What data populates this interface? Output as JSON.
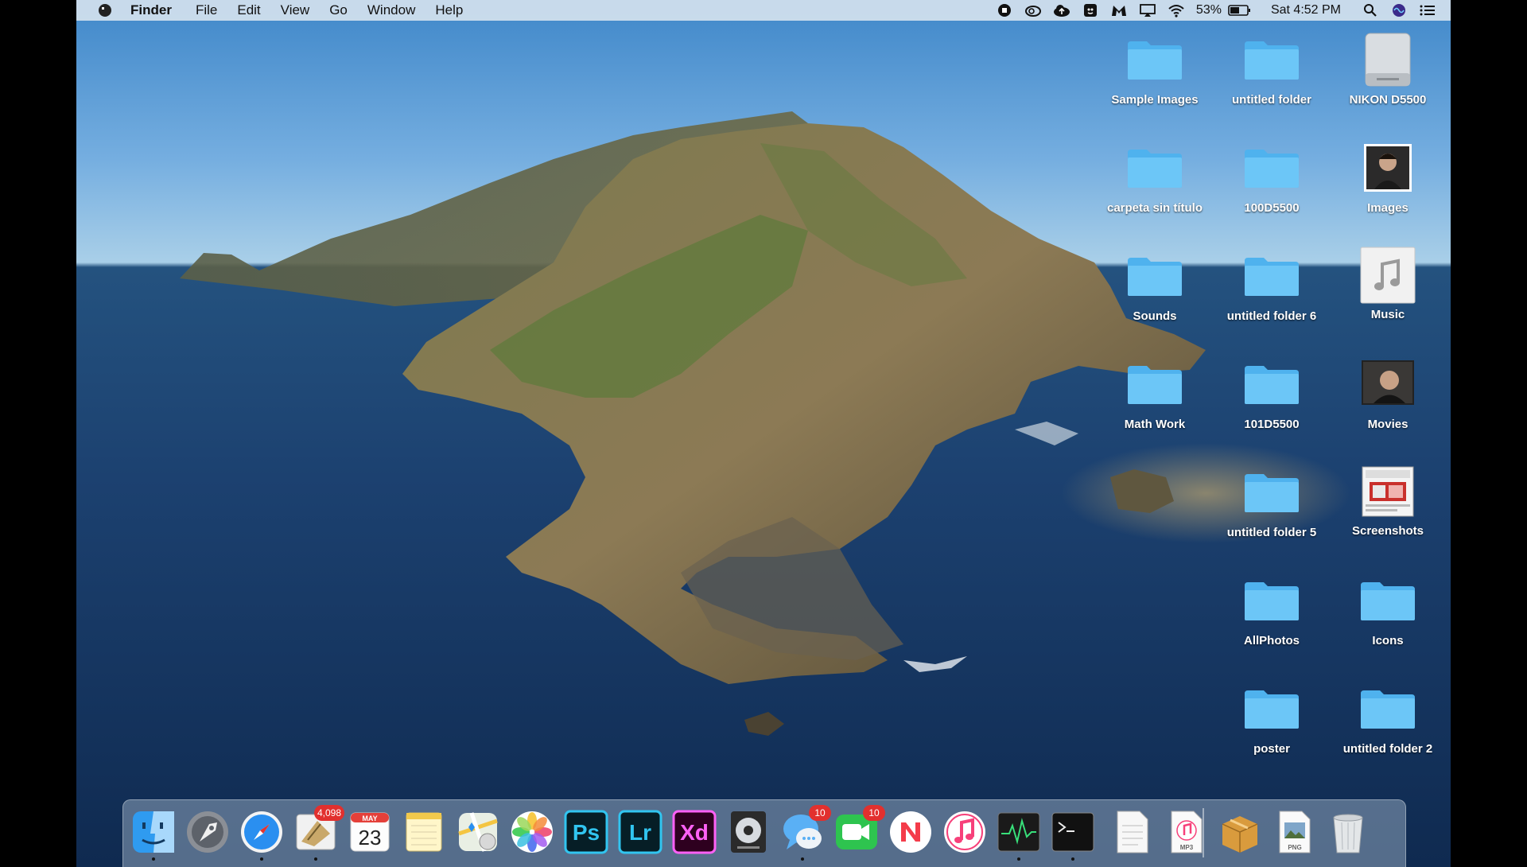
{
  "menubar": {
    "app_name": "Finder",
    "menus": [
      "File",
      "Edit",
      "View",
      "Go",
      "Window",
      "Help"
    ],
    "battery": "53%",
    "clock": "Sat 4:52 PM",
    "status_icons": [
      "record-icon",
      "creative-cloud-icon",
      "cloud-upload-icon",
      "ghostery-icon",
      "malwarebytes-icon",
      "airplay-icon",
      "wifi-icon",
      "battery-icon",
      "spotlight-icon",
      "siri-icon",
      "notification-center-icon"
    ]
  },
  "desktop": {
    "items": [
      {
        "label": "Sample Images",
        "icon": "folder-icon"
      },
      {
        "label": "untitled folder",
        "icon": "folder-icon"
      },
      {
        "label": "NIKON D5500",
        "icon": "drive-icon"
      },
      {
        "label": "carpeta sin título",
        "icon": "folder-icon"
      },
      {
        "label": "100D5500",
        "icon": "folder-icon"
      },
      {
        "label": "Images",
        "icon": "portrait-thumbnail-icon"
      },
      {
        "label": "Sounds",
        "icon": "folder-icon"
      },
      {
        "label": "untitled folder 6",
        "icon": "folder-icon"
      },
      {
        "label": "Music",
        "icon": "music-file-icon"
      },
      {
        "label": "Math Work",
        "icon": "folder-icon"
      },
      {
        "label": "101D5500",
        "icon": "folder-icon"
      },
      {
        "label": "Movies",
        "icon": "video-thumbnail-icon"
      },
      {
        "label": "untitled folder 5",
        "icon": "folder-icon"
      },
      {
        "label": "Screenshots",
        "icon": "screenshot-thumbnail-icon"
      },
      {
        "label": "AllPhotos",
        "icon": "folder-icon"
      },
      {
        "label": "Icons",
        "icon": "folder-icon"
      },
      {
        "label": "poster",
        "icon": "folder-icon"
      },
      {
        "label": "untitled folder 2",
        "icon": "folder-icon"
      }
    ]
  },
  "dock": {
    "apps": [
      {
        "name": "Finder",
        "icon": "finder-icon",
        "running": true
      },
      {
        "name": "Launchpad",
        "icon": "launchpad-icon",
        "running": false
      },
      {
        "name": "Safari",
        "icon": "safari-icon",
        "running": true
      },
      {
        "name": "Mail",
        "icon": "mail-icon",
        "badge": "4,098",
        "running": true
      },
      {
        "name": "Calendar",
        "icon": "calendar-icon",
        "month": "MAY",
        "day": "23",
        "running": false
      },
      {
        "name": "Notes",
        "icon": "notes-icon",
        "running": false
      },
      {
        "name": "Maps",
        "icon": "maps-icon",
        "running": false
      },
      {
        "name": "Photos",
        "icon": "photos-icon",
        "running": false
      },
      {
        "name": "Photoshop",
        "icon": "photoshop-icon",
        "text": "Ps",
        "running": false
      },
      {
        "name": "Lightroom",
        "icon": "lightroom-icon",
        "text": "Lr",
        "running": false
      },
      {
        "name": "Adobe XD",
        "icon": "xd-icon",
        "text": "Xd",
        "running": false
      },
      {
        "name": "Compressor",
        "icon": "compressor-icon",
        "running": false
      },
      {
        "name": "Messages",
        "icon": "messages-icon",
        "badge": "10",
        "running": true
      },
      {
        "name": "FaceTime",
        "icon": "facetime-icon",
        "badge": "10",
        "running": false
      },
      {
        "name": "News",
        "icon": "news-icon",
        "running": false
      },
      {
        "name": "Music",
        "icon": "itunes-icon",
        "running": false
      },
      {
        "name": "Activity Monitor",
        "icon": "activity-monitor-icon",
        "running": true
      },
      {
        "name": "Terminal",
        "icon": "terminal-icon",
        "running": true
      }
    ],
    "stack": [
      {
        "name": "Document",
        "icon": "document-icon"
      },
      {
        "name": "MP3",
        "icon": "mp3-file-icon",
        "text": "MP3"
      },
      {
        "name": "Package",
        "icon": "package-icon"
      },
      {
        "name": "PNG",
        "icon": "png-file-icon",
        "text": "PNG"
      },
      {
        "name": "Trash",
        "icon": "trash-icon"
      }
    ]
  }
}
